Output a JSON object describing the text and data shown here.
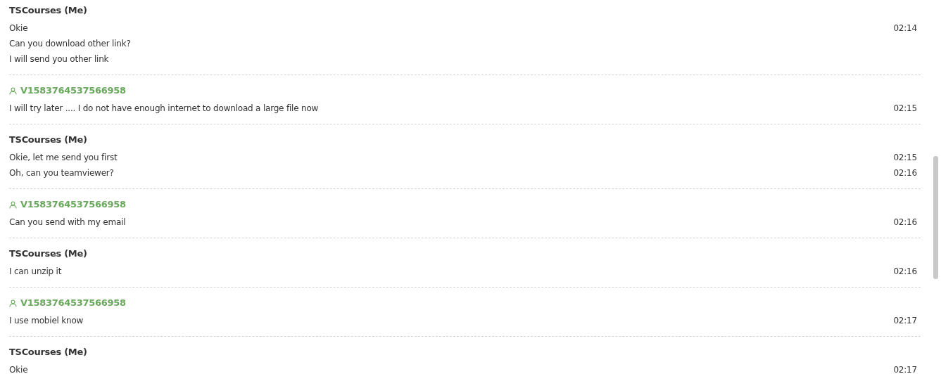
{
  "messages_groups": [
    {
      "kind": "me",
      "sender": "TSCourses (Me)",
      "messages": [
        {
          "text": "Okie",
          "time": "02:14"
        },
        {
          "text": "Can you download other link?"
        },
        {
          "text": "I will send you other link"
        }
      ]
    },
    {
      "kind": "visitor",
      "sender": "V1583764537566958",
      "messages": [
        {
          "text": "I will try later .... I do not have enough internet to download a large file now",
          "time": "02:15"
        }
      ]
    },
    {
      "kind": "me",
      "sender": "TSCourses (Me)",
      "messages": [
        {
          "text": "Okie, let me send you first",
          "time": "02:15"
        },
        {
          "text": "Oh, can you teamviewer?",
          "time": "02:16"
        }
      ]
    },
    {
      "kind": "visitor",
      "sender": "V1583764537566958",
      "messages": [
        {
          "text": "Can you send with my email",
          "time": "02:16"
        }
      ]
    },
    {
      "kind": "me",
      "sender": "TSCourses (Me)",
      "messages": [
        {
          "text": "I can unzip it",
          "time": "02:16"
        }
      ]
    },
    {
      "kind": "visitor",
      "sender": "V1583764537566958",
      "messages": [
        {
          "text": "I use mobiel know",
          "time": "02:17"
        }
      ]
    },
    {
      "kind": "me",
      "sender": "TSCourses (Me)",
      "messages": [
        {
          "text": "Okie",
          "time": "02:17"
        }
      ]
    }
  ]
}
